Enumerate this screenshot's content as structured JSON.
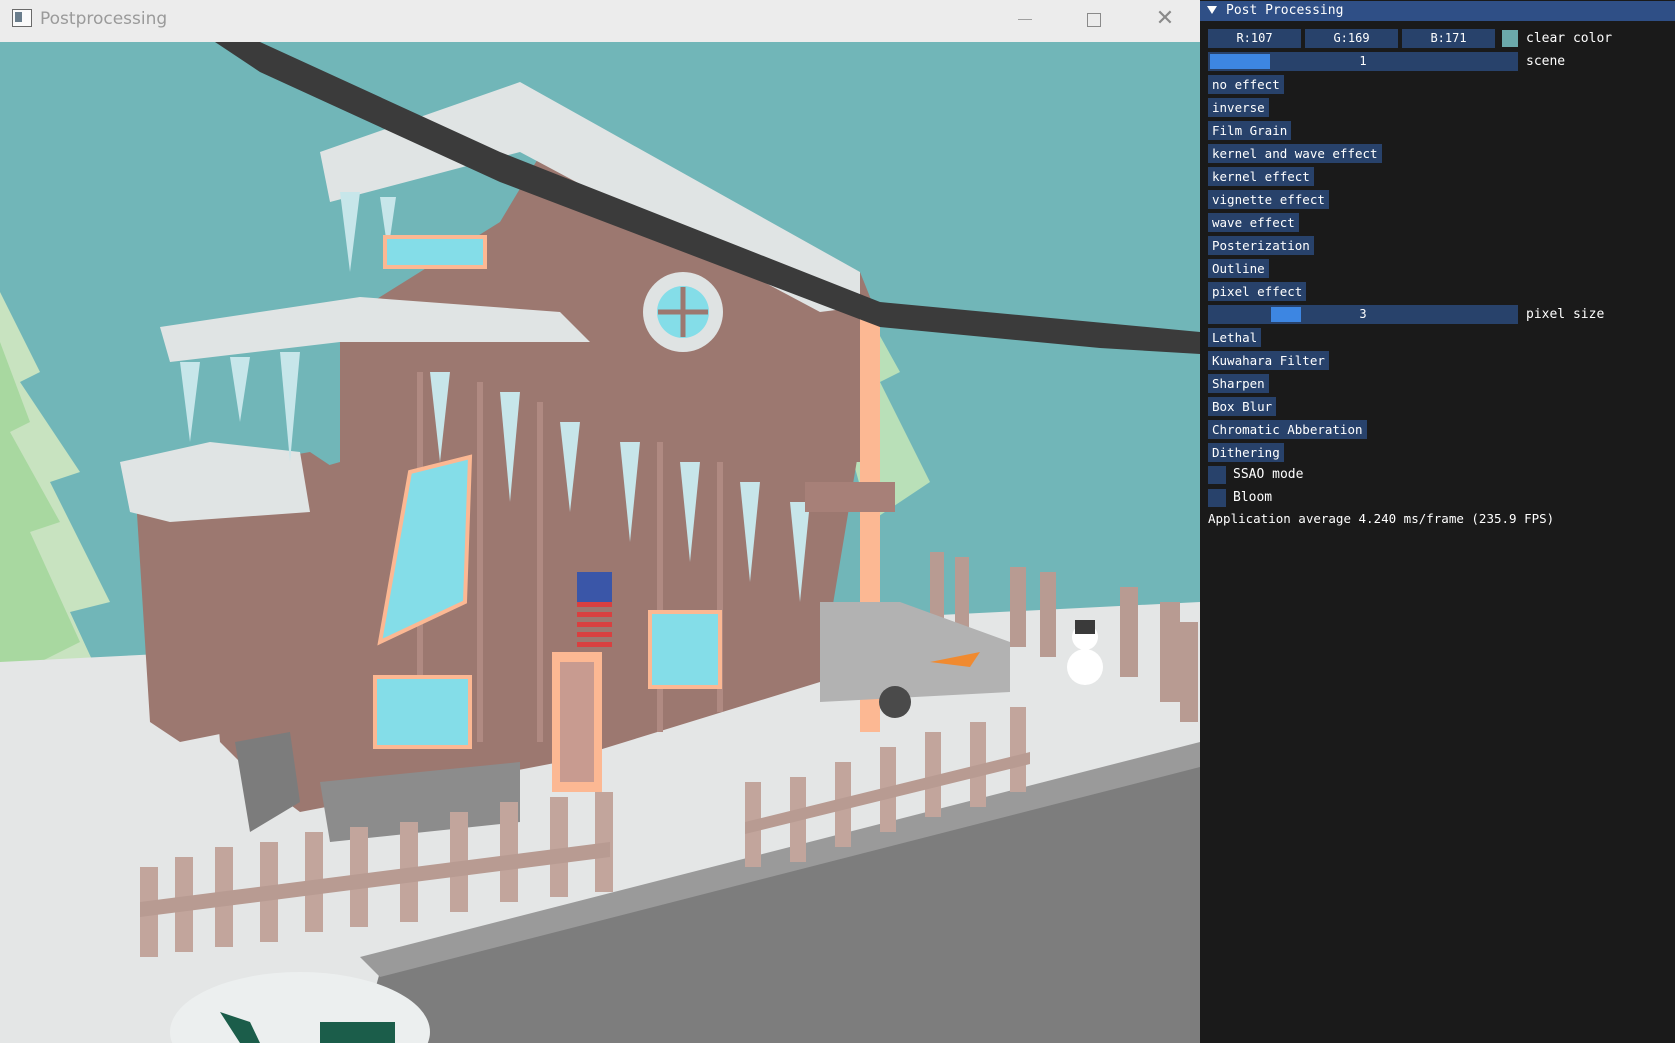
{
  "window": {
    "title": "Postprocessing",
    "controls": {
      "minimize": "minimize",
      "maximize": "maximize",
      "close": "✕"
    }
  },
  "panel": {
    "title": "Post Processing",
    "clear_color": {
      "r_label": "R:107",
      "g_label": "G:169",
      "b_label": "B:171",
      "swatch_color": "#6ba9ab",
      "label": "clear color"
    },
    "scene_slider": {
      "value": "1",
      "label": "scene"
    },
    "buttons_top": [
      "no effect",
      "inverse",
      "Film Grain",
      "kernel and wave effect",
      "kernel effect",
      "vignette effect",
      "wave effect",
      "Posterization",
      "Outline",
      "pixel effect"
    ],
    "pixel_size_slider": {
      "value": "3",
      "label": "pixel size"
    },
    "buttons_bottom": [
      "Lethal",
      "Kuwahara Filter",
      "Sharpen",
      "Box Blur",
      "Chromatic Abberation",
      "Dithering"
    ],
    "checkboxes": [
      {
        "label": "SSAO mode",
        "checked": false
      },
      {
        "label": "Bloom",
        "checked": false
      }
    ],
    "fps_text": "Application average 4.240 ms/frame (235.9 FPS)"
  },
  "colors": {
    "accent": "#3d86e2",
    "header": "#2f4f86",
    "frame": "#28426b",
    "panel_bg": "#1a1a1a",
    "sky": "#71b6b8"
  },
  "scene": {
    "description_icon": "snowy-house-scene"
  }
}
